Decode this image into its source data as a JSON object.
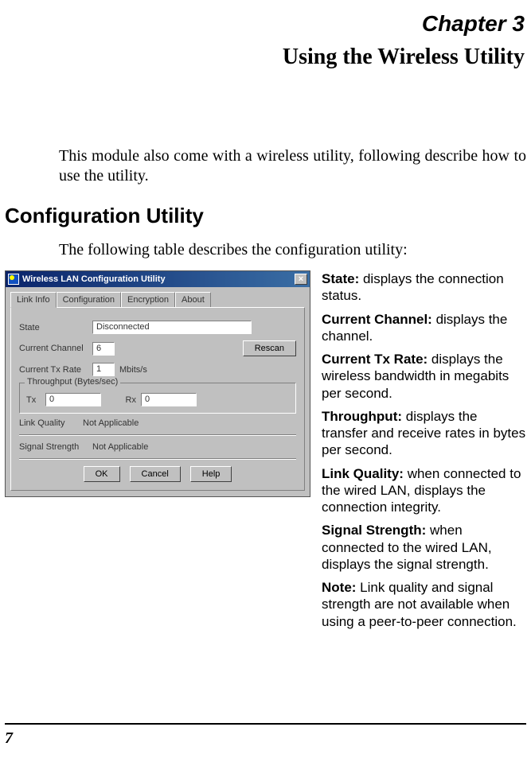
{
  "chapter": "Chapter 3",
  "title": "Using the Wireless Utility",
  "intro": "This module also come with a wireless utility, following describe how to use the utility.",
  "section_heading": "Configuration Utility",
  "table_desc": "The following table describes the configuration utility:",
  "dialog": {
    "title": "Wireless LAN Configuration Utility",
    "tabs": [
      "Link Info",
      "Configuration",
      "Encryption",
      "About"
    ],
    "fields": {
      "state_label": "State",
      "state_value": "Disconnected",
      "channel_label": "Current Channel",
      "channel_value": "6",
      "txrate_label": "Current Tx Rate",
      "txrate_value": "1",
      "txrate_unit": "Mbits/s",
      "rescan_btn": "Rescan",
      "throughput_group": "Throughput (Bytes/sec)",
      "tx_label": "Tx",
      "tx_value": "0",
      "rx_label": "Rx",
      "rx_value": "0",
      "link_quality_label": "Link Quality",
      "link_quality_value": "Not Applicable",
      "signal_label": "Signal Strength",
      "signal_value": "Not Applicable"
    },
    "buttons": {
      "ok": "OK",
      "cancel": "Cancel",
      "help": "Help"
    }
  },
  "definitions": [
    {
      "term": "State:",
      "text": " displays the connection status."
    },
    {
      "term": "Current Channel:",
      "text": " displays the channel."
    },
    {
      "term": "Current Tx Rate:",
      "text": " displays the wireless bandwidth in megabits per second."
    },
    {
      "term": "Throughput:",
      "text": " displays the transfer and receive rates in bytes per second."
    },
    {
      "term": "Link Quality:",
      "text": " when connected to the wired LAN, displays the connection integrity."
    },
    {
      "term": "Signal Strength:",
      "text": " when connected to the wired LAN, displays the signal strength."
    },
    {
      "term": "Note:",
      "text": " Link quality and signal strength are not available when using a peer-to-peer connection."
    }
  ],
  "page_number": "7"
}
